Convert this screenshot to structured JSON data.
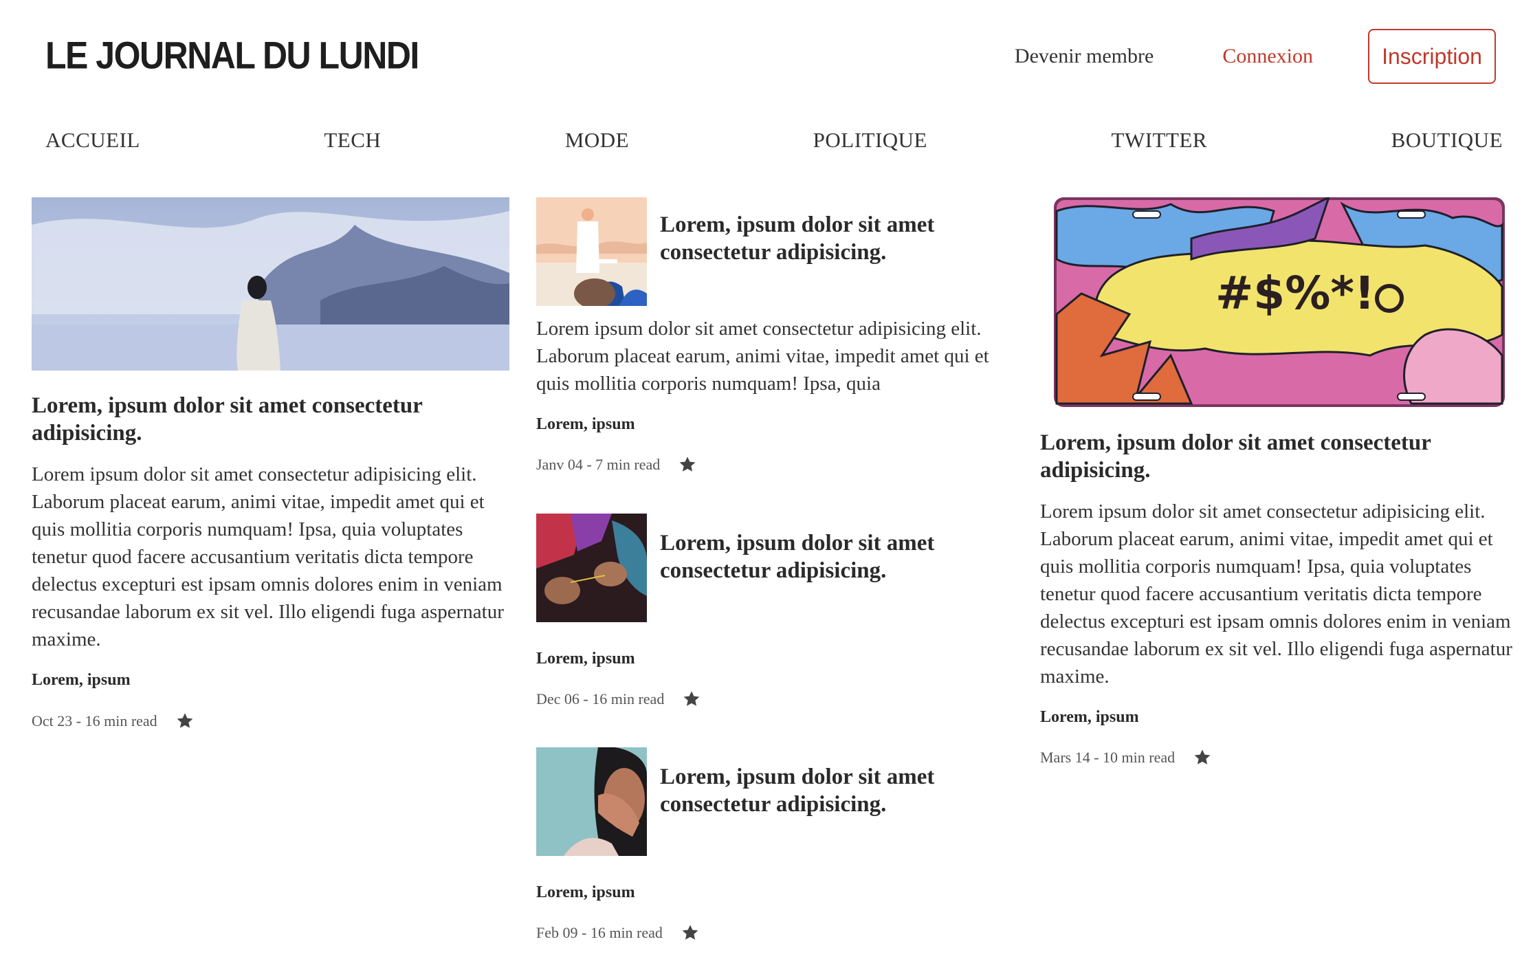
{
  "header": {
    "logo": "LE JOURNAL DU LUNDI",
    "member_link": "Devenir membre",
    "login_link": "Connexion",
    "signup_button": "Inscription",
    "accent_color": "#c0392b"
  },
  "nav": {
    "items": [
      "ACCUEIL",
      "TECH",
      "MODE",
      "POLITIQUE",
      "TWITTER",
      "BOUTIQUE"
    ]
  },
  "featured_left": {
    "image": "man-standing-before-icy-mountain-photo",
    "title": "Lorem, ipsum dolor sit amet consectetur adipisicing.",
    "excerpt": "Lorem ipsum dolor sit amet consectetur adipisicing elit. Laborum placeat earum, animi vitae, impedit amet qui et quis mollitia corporis numquam! Ipsa, quia voluptates tenetur quod facere accusantium veritatis dicta tempore delectus excepturi est ipsam omnis dolores enim in veniam recusandae laborum ex sit vel. Illo eligendi fuga aspernatur maxime.",
    "author": "Lorem, ipsum",
    "meta": "Oct 23 - 16 min read",
    "star_icon": "star-icon"
  },
  "middle_articles": [
    {
      "image": "man-in-white-coat-illustration",
      "title": "Lorem, ipsum dolor sit amet consectetur adipisicing.",
      "excerpt": "Lorem ipsum dolor sit amet consectetur adipisicing elit. Laborum placeat earum, animi vitae, impedit amet qui et quis mollitia corporis numquam! Ipsa, quia",
      "author": "Lorem, ipsum",
      "meta": "Janv 04 - 7 min read"
    },
    {
      "image": "hands-weaving-thread-photo",
      "title": "Lorem, ipsum dolor sit amet consectetur adipisicing.",
      "author": "Lorem, ipsum",
      "meta": "Dec 06 - 16 min read"
    },
    {
      "image": "woman-covering-mouth-photo",
      "title": "Lorem, ipsum dolor sit amet consectetur adipisicing.",
      "author": "Lorem, ipsum",
      "meta": "Feb 09 - 16 min read"
    }
  ],
  "featured_right": {
    "image": "comic-license-plate-illustration",
    "plate_text": "#$%*!",
    "title": "Lorem, ipsum dolor sit amet consectetur adipisicing.",
    "excerpt": "Lorem ipsum dolor sit amet consectetur adipisicing elit. Laborum placeat earum, animi vitae, impedit amet qui et quis mollitia corporis numquam! Ipsa, quia voluptates tenetur quod facere accusantium veritatis dicta tempore delectus excepturi est ipsam omnis dolores enim in veniam recusandae laborum ex sit vel. Illo eligendi fuga aspernatur maxime.",
    "author": "Lorem, ipsum",
    "meta": "Mars 14 - 10 min read"
  }
}
